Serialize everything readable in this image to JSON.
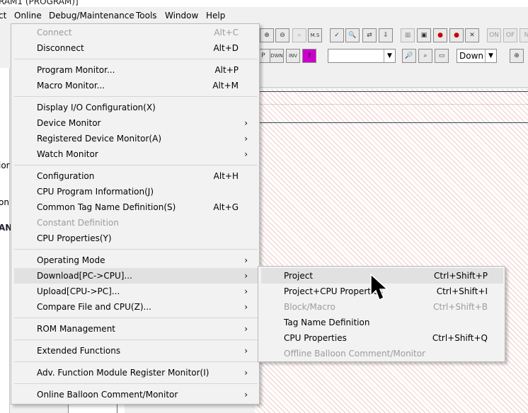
{
  "window": {
    "title_fragment": "RAM1 (PROGRAM)]"
  },
  "menubar": {
    "items": [
      "ct",
      "Online",
      "Debug/Maintenance",
      "Tools",
      "Window",
      "Help"
    ]
  },
  "left_fragments": [
    "ior",
    "on",
    "AN"
  ],
  "toolbar": {
    "combo_value": "",
    "direction_value": "Down",
    "icons": [
      "zoom-in-icon",
      "zoom-out-icon",
      "zoom-area-icon",
      "ms-icon",
      "check-icon",
      "find-icon",
      "find-replace-icon",
      "jump-icon",
      "monitor-icon",
      "device-icon",
      "stop-icon",
      "run-icon",
      "tools-icon",
      "on-icon",
      "off-icon",
      "extra-icon"
    ],
    "labels": {
      "p_btn": "P",
      "dwn_btn": "DWN",
      "inv_btn": "INV",
      "q_btn": "?"
    }
  },
  "online_menu": {
    "items": [
      {
        "label": "Connect",
        "shortcut": "Alt+C",
        "disabled": true
      },
      {
        "label": "Disconnect",
        "shortcut": "Alt+D"
      },
      {
        "label": "Program Monitor...",
        "shortcut": "Alt+P"
      },
      {
        "label": "Macro Monitor...",
        "shortcut": "Alt+M"
      },
      {
        "label": "Display I/O Configuration(X)",
        "shortcut": ""
      },
      {
        "label": "Device Monitor",
        "shortcut": "",
        "submenu": true
      },
      {
        "label": "Registered Device Monitor(A)",
        "shortcut": "",
        "submenu": true
      },
      {
        "label": "Watch Monitor",
        "shortcut": "",
        "submenu": true
      },
      {
        "label": "Configuration",
        "shortcut": "Alt+H"
      },
      {
        "label": "CPU Program Information(J)",
        "shortcut": ""
      },
      {
        "label": "Common Tag Name Definition(S)",
        "shortcut": "Alt+G"
      },
      {
        "label": "Constant Definition",
        "shortcut": "",
        "disabled": true
      },
      {
        "label": "CPU Properties(Y)",
        "shortcut": ""
      },
      {
        "label": "Operating Mode",
        "shortcut": "",
        "submenu": true
      },
      {
        "label": "Download[PC->CPU]...",
        "shortcut": "",
        "submenu": true,
        "highlighted": true
      },
      {
        "label": "Upload[CPU->PC]...",
        "shortcut": "",
        "submenu": true
      },
      {
        "label": "Compare File and CPU(Z)...",
        "shortcut": "",
        "submenu": true
      },
      {
        "label": "ROM Management",
        "shortcut": "",
        "submenu": true
      },
      {
        "label": "Extended Functions",
        "shortcut": "",
        "submenu": true
      },
      {
        "label": "Adv. Function Module Register Monitor(I)",
        "shortcut": "",
        "submenu": true
      },
      {
        "label": "Online Balloon Comment/Monitor",
        "shortcut": "",
        "submenu": true
      }
    ],
    "chevron": "›"
  },
  "download_submenu": {
    "items": [
      {
        "label": "Project",
        "shortcut": "Ctrl+Shift+P",
        "highlighted": true
      },
      {
        "label": "Project+CPU Properties",
        "shortcut": "Ctrl+Shift+I"
      },
      {
        "label": "Block/Macro",
        "shortcut": "Ctrl+Shift+B",
        "disabled": true
      },
      {
        "label": "Tag Name Definition",
        "shortcut": ""
      },
      {
        "label": "CPU Properties",
        "shortcut": "Ctrl+Shift+Q"
      },
      {
        "label": "Offline Balloon Comment/Monitor",
        "shortcut": "",
        "disabled": true
      }
    ]
  }
}
